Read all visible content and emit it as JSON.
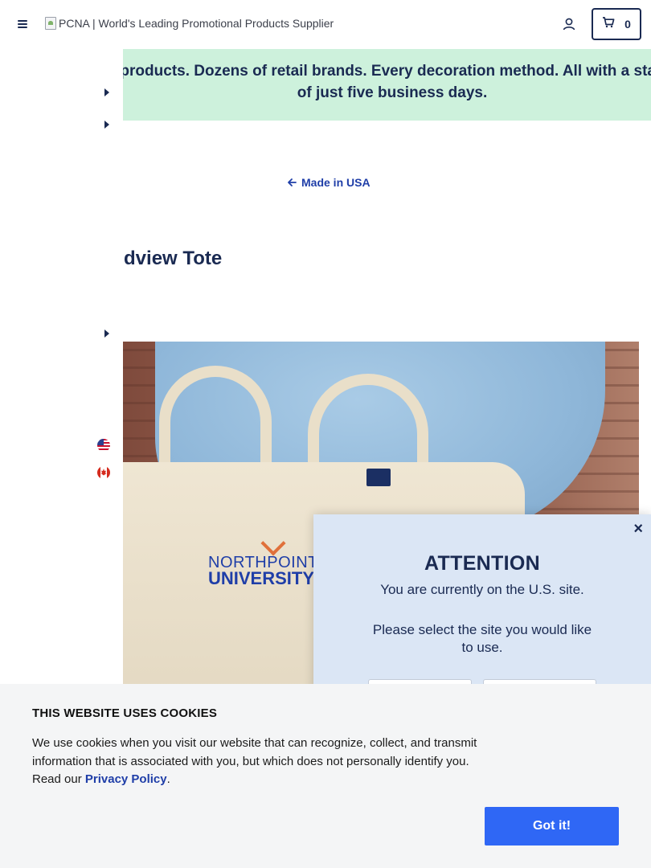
{
  "header": {
    "menu_icon": "hamburger-menu-icon",
    "logo_alt": "PCNA | World's Leading Promotional Products Supplier",
    "account_icon": "user-account-icon",
    "cart_icon": "shopping-cart-icon",
    "cart_count": "0"
  },
  "banner": {
    "text": "Thousands of products. Dozens of retail brands. Every decoration method. All with a standard lead time of just five business days.",
    "background": "#cdf1dc"
  },
  "left_rail": {
    "flags": [
      "us-flag-icon",
      "canada-flag-icon"
    ]
  },
  "breadcrumb": {
    "back_label": "Made in USA"
  },
  "product": {
    "title": "Grandview Tote",
    "image_logo_line1": "NORTHPOINT",
    "image_logo_line2": "UNIVERSITY"
  },
  "site_modal": {
    "close_label": "×",
    "title": "ATTENTION",
    "current_site": "You are currently on the U.S. site.",
    "select_prompt": "Please select the site you would like to use."
  },
  "cookie_banner": {
    "title": "THIS WEBSITE USES COOKIES",
    "text_before_link": "We use cookies when you visit our website that can recognize, collect, and transmit information that is associated with you, but which does not personally identify you. Read our ",
    "link_label": "Privacy Policy",
    "text_after_link": ".",
    "accept_label": "Got it!"
  },
  "colors": {
    "navy": "#1a2a52",
    "link_blue": "#1f3ea8",
    "accept_button": "#2f67f5",
    "modal_bg": "#dbe6f5",
    "cookie_bg": "#f4f5f6"
  }
}
